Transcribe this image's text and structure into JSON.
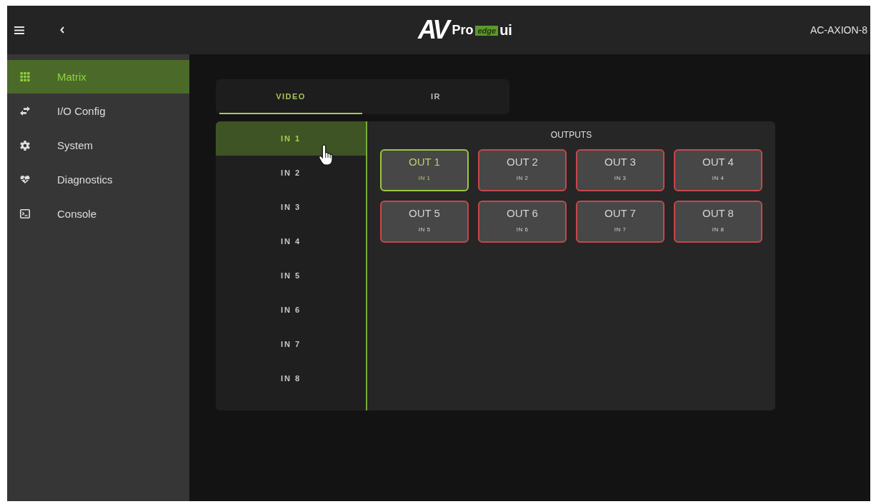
{
  "header": {
    "logo": {
      "mark": "AV",
      "word": "Pro",
      "badge": "edge",
      "suffix": "ui"
    },
    "device_name": "AC-AXION-8"
  },
  "sidebar": {
    "items": [
      {
        "kind": "grid",
        "label": "Matrix",
        "selected": true
      },
      {
        "kind": "arrows",
        "label": "I/O Config",
        "selected": false
      },
      {
        "kind": "gear",
        "label": "System",
        "selected": false
      },
      {
        "kind": "heart",
        "label": "Diagnostics",
        "selected": false
      },
      {
        "kind": "terminal",
        "label": "Console",
        "selected": false
      }
    ]
  },
  "tabs": [
    {
      "label": "VIDEO",
      "selected": true
    },
    {
      "label": "IR",
      "selected": false
    }
  ],
  "inputs": [
    {
      "label": "IN 1",
      "selected": true
    },
    {
      "label": "IN 2",
      "selected": false
    },
    {
      "label": "IN 3",
      "selected": false
    },
    {
      "label": "IN 4",
      "selected": false
    },
    {
      "label": "IN 5",
      "selected": false
    },
    {
      "label": "IN 6",
      "selected": false
    },
    {
      "label": "IN 7",
      "selected": false
    },
    {
      "label": "IN 8",
      "selected": false
    }
  ],
  "outputs": {
    "title": "OUTPUTS",
    "items": [
      {
        "label": "OUT 1",
        "source": "IN 1",
        "selected": true
      },
      {
        "label": "OUT 2",
        "source": "IN 2",
        "selected": false
      },
      {
        "label": "OUT 3",
        "source": "IN 3",
        "selected": false
      },
      {
        "label": "OUT 4",
        "source": "IN 4",
        "selected": false
      },
      {
        "label": "OUT 5",
        "source": "IN 5",
        "selected": false
      },
      {
        "label": "OUT 6",
        "source": "IN 6",
        "selected": false
      },
      {
        "label": "OUT 7",
        "source": "IN 7",
        "selected": false
      },
      {
        "label": "OUT 8",
        "source": "IN 8",
        "selected": false
      }
    ]
  }
}
